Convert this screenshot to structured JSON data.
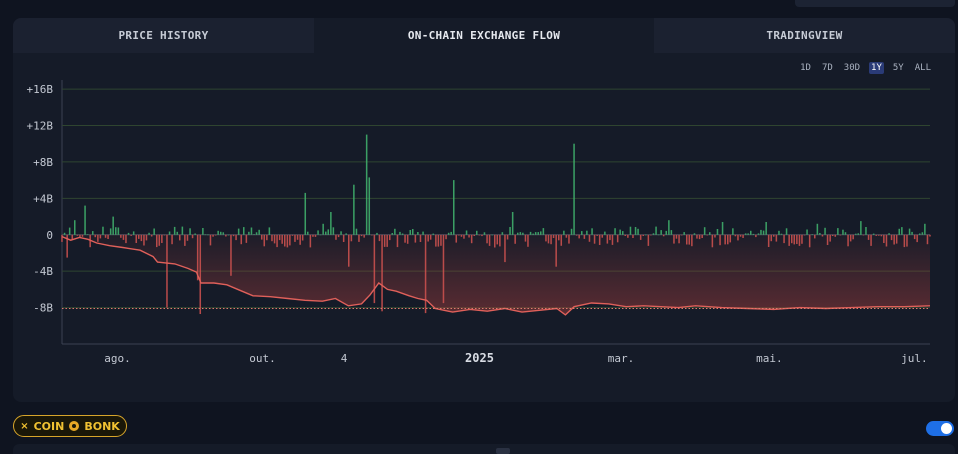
{
  "tabs": [
    {
      "label": "PRICE HISTORY",
      "active": false
    },
    {
      "label": "ON-CHAIN EXCHANGE FLOW",
      "active": true
    },
    {
      "label": "TRADINGVIEW",
      "active": false
    }
  ],
  "ranges": [
    {
      "label": "1D",
      "selected": false
    },
    {
      "label": "7D",
      "selected": false
    },
    {
      "label": "30D",
      "selected": false
    },
    {
      "label": "1Y",
      "selected": true
    },
    {
      "label": "5Y",
      "selected": false
    },
    {
      "label": "ALL",
      "selected": false
    }
  ],
  "chart_data": {
    "type": "bar",
    "y_ticks": [
      "+16B",
      "+12B",
      "+8B",
      "+4B",
      "0",
      "-4B",
      "-8B"
    ],
    "y_tick_values": [
      16,
      12,
      8,
      4,
      0,
      -4,
      -8
    ],
    "ylim": [
      -12,
      17
    ],
    "x_ticks": [
      {
        "label": "ago.",
        "t": 0.064,
        "bold": false
      },
      {
        "label": "out.",
        "t": 0.231,
        "bold": false
      },
      {
        "label": "4",
        "t": 0.325,
        "bold": false
      },
      {
        "label": "2025",
        "t": 0.481,
        "bold": true
      },
      {
        "label": "mar.",
        "t": 0.644,
        "bold": false
      },
      {
        "label": "mai.",
        "t": 0.815,
        "bold": false
      },
      {
        "label": "jul.",
        "t": 0.982,
        "bold": false
      }
    ],
    "series": [
      {
        "type": "bar",
        "unit": "B",
        "color_positive": "#3fae6a",
        "color_negative": "#c9504e"
      },
      {
        "type": "area",
        "unit": "B",
        "line_color": "#e0605a",
        "points": [
          [
            0.0,
            -0.2
          ],
          [
            0.01,
            -0.6
          ],
          [
            0.02,
            -0.3
          ],
          [
            0.03,
            -0.5
          ],
          [
            0.04,
            -0.9
          ],
          [
            0.055,
            -1.2
          ],
          [
            0.07,
            -1.4
          ],
          [
            0.09,
            -1.7
          ],
          [
            0.105,
            -2.4
          ],
          [
            0.11,
            -3.0
          ],
          [
            0.13,
            -3.2
          ],
          [
            0.145,
            -3.7
          ],
          [
            0.155,
            -4.1
          ],
          [
            0.16,
            -5.3
          ],
          [
            0.175,
            -5.3
          ],
          [
            0.19,
            -5.5
          ],
          [
            0.205,
            -6.1
          ],
          [
            0.22,
            -6.7
          ],
          [
            0.24,
            -6.8
          ],
          [
            0.26,
            -7.0
          ],
          [
            0.28,
            -7.2
          ],
          [
            0.3,
            -7.3
          ],
          [
            0.315,
            -7.0
          ],
          [
            0.33,
            -7.8
          ],
          [
            0.345,
            -7.6
          ],
          [
            0.355,
            -6.6
          ],
          [
            0.365,
            -5.3
          ],
          [
            0.375,
            -6.0
          ],
          [
            0.385,
            -6.2
          ],
          [
            0.4,
            -6.7
          ],
          [
            0.41,
            -7.0
          ],
          [
            0.42,
            -7.2
          ],
          [
            0.43,
            -8.1
          ],
          [
            0.45,
            -8.5
          ],
          [
            0.47,
            -8.2
          ],
          [
            0.49,
            -8.4
          ],
          [
            0.51,
            -8.1
          ],
          [
            0.53,
            -8.5
          ],
          [
            0.55,
            -8.3
          ],
          [
            0.57,
            -8.1
          ],
          [
            0.58,
            -8.8
          ],
          [
            0.59,
            -7.9
          ],
          [
            0.61,
            -7.5
          ],
          [
            0.63,
            -7.6
          ],
          [
            0.65,
            -7.9
          ],
          [
            0.67,
            -7.8
          ],
          [
            0.69,
            -7.9
          ],
          [
            0.71,
            -8.0
          ],
          [
            0.73,
            -7.8
          ],
          [
            0.76,
            -8.0
          ],
          [
            0.79,
            -8.1
          ],
          [
            0.82,
            -8.2
          ],
          [
            0.85,
            -8.0
          ],
          [
            0.88,
            -8.1
          ],
          [
            0.91,
            -8.0
          ],
          [
            0.94,
            -7.9
          ],
          [
            0.97,
            -7.9
          ],
          [
            1.0,
            -7.8
          ]
        ]
      }
    ],
    "reference_line": -8.1,
    "grid": true
  },
  "filter_pill": {
    "close_symbol": "×",
    "label_a": "COIN",
    "label_b": "BONK"
  }
}
